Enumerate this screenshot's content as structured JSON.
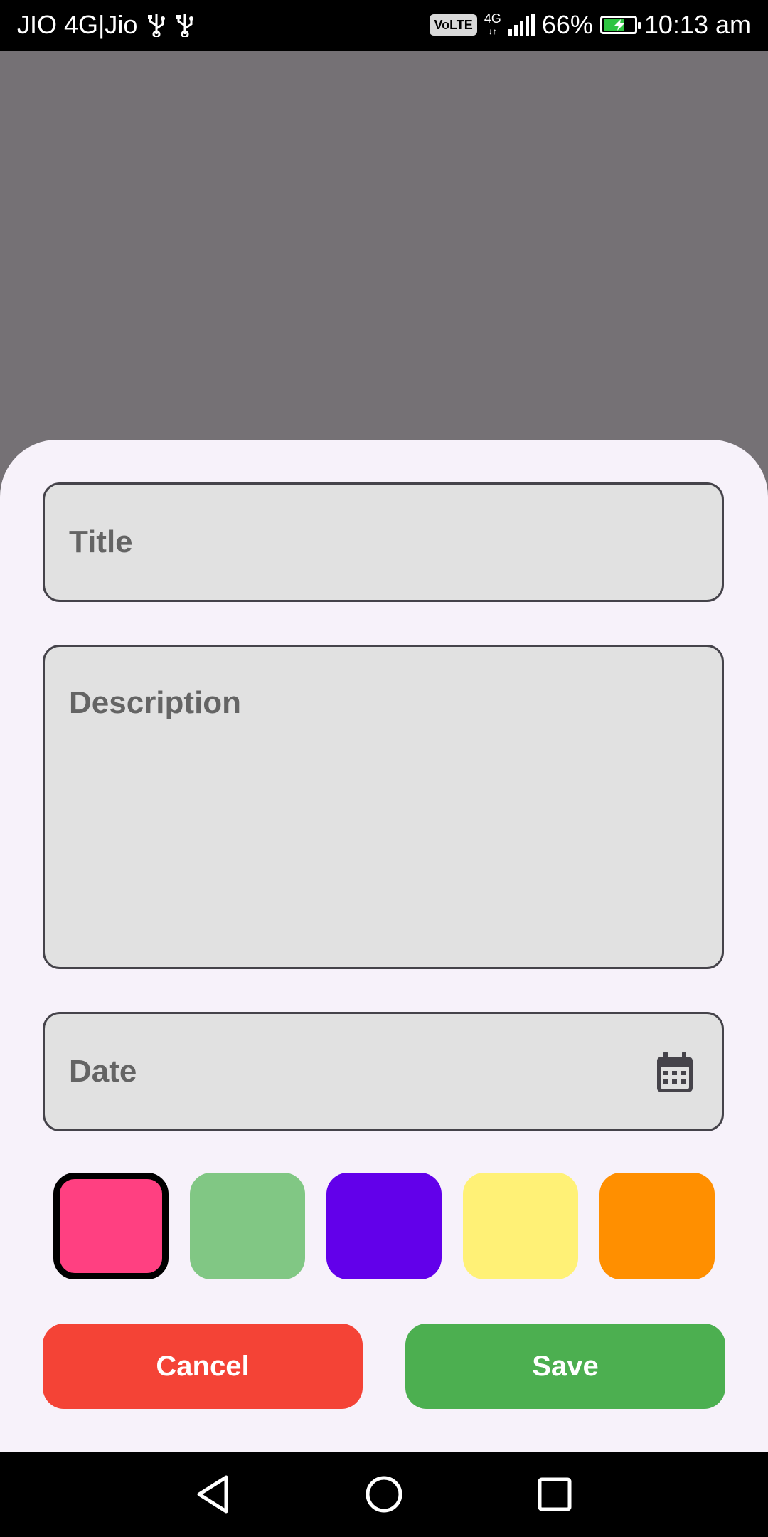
{
  "status_bar": {
    "carrier": "JIO 4G|Jio",
    "usb_icons": [
      "usb-icon",
      "usb-icon"
    ],
    "volte": "VoLTE",
    "network": "4G",
    "battery_percent": "66%",
    "battery_level": 0.66,
    "time": "10:13 am"
  },
  "form": {
    "title_placeholder": "Title",
    "description_placeholder": "Description",
    "date_placeholder": "Date",
    "date_icon": "calendar-icon"
  },
  "colors": {
    "options": [
      "#FF4081",
      "#81C784",
      "#6200EA",
      "#FFF176",
      "#FF8F00"
    ],
    "selected_index": 0
  },
  "actions": {
    "cancel_label": "Cancel",
    "save_label": "Save",
    "cancel_color": "#F44336",
    "save_color": "#4CAF50"
  },
  "nav": {
    "back": "back-icon",
    "home": "home-icon",
    "recents": "recents-icon"
  }
}
